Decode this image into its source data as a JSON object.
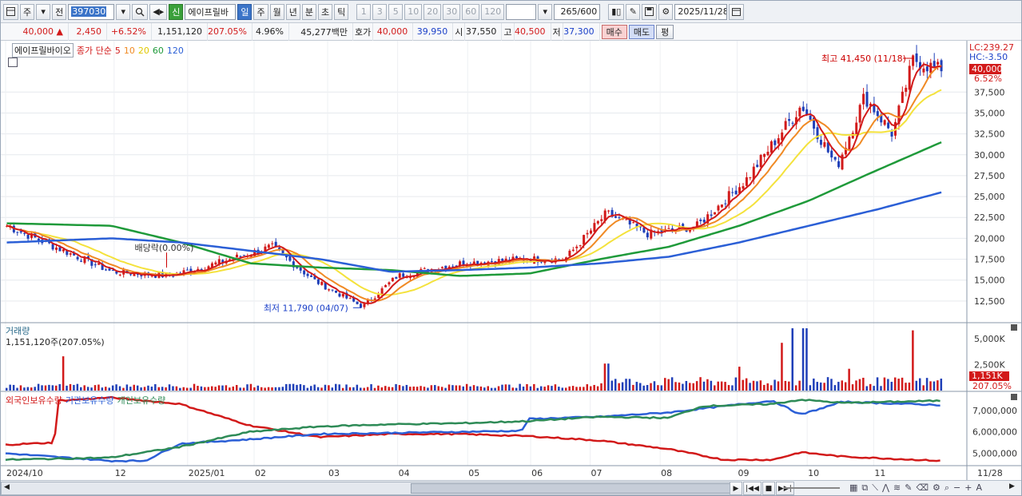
{
  "toolbar": {
    "period_first": "주",
    "prev_label": "전",
    "stock_code": "397030",
    "new_badge": "신",
    "stock_name": "에이프릴바",
    "tabs": [
      "일",
      "주",
      "월",
      "년",
      "분",
      "초",
      "틱"
    ],
    "active_tab": "일",
    "intervals": [
      "1",
      "3",
      "5",
      "10",
      "20",
      "30",
      "60",
      "120"
    ],
    "count": "265",
    "count_total": "/600",
    "date": "2025/11/28"
  },
  "quote": {
    "price": "40,000",
    "change": "2,450",
    "change_pct": "+6.52%",
    "volume": "1,151,120",
    "volume_ratio": "207.05%",
    "turnover": "4.96%",
    "amount": "45,277백만",
    "bid_label": "호가",
    "ask": "40,000",
    "bid": "39,950",
    "open_label": "시",
    "open": "37,550",
    "high_label": "고",
    "high": "40,500",
    "low_label": "저",
    "low": "37,300",
    "buy_label": "매수",
    "sell_label": "매도",
    "flat_label": "평"
  },
  "price_panel": {
    "stock_name": "에이프릴바이오",
    "ma_label": "종가 단순",
    "ma_periods": [
      "5",
      "10",
      "20",
      "60",
      "120"
    ],
    "ma_colors": [
      "#d21a1a",
      "#f08a24",
      "#f4e23c",
      "#1f9a3a",
      "#2b5fd6"
    ],
    "high_annotation": "최고 41,450 (11/18)",
    "low_annotation": "최저 11,790 (04/07)",
    "dividend_annotation": "배당락(0.00%)",
    "lc_label": "LC:239.27",
    "hc_label": "HC:-3.50",
    "current_tag": "40,000",
    "current_pct": "6.52%",
    "y_ticks": [
      "37,500",
      "35,000",
      "32,500",
      "30,000",
      "27,500",
      "25,000",
      "22,500",
      "20,000",
      "17,500",
      "15,000",
      "12,500"
    ]
  },
  "volume_panel": {
    "title": "거래량",
    "value": "1,151,120주(207.05%)",
    "y_ticks": [
      "5,000K",
      "2,500K"
    ],
    "current_tag": "1,151K",
    "current_pct": "207.05%"
  },
  "holdings_panel": {
    "series": [
      "외국인보유수량",
      "기관보유수량",
      "개인보유수량"
    ],
    "series_colors": [
      "#d21a1a",
      "#2b5fd6",
      "#2e8b57"
    ],
    "y_ticks": [
      "7,000,000",
      "6,000,000",
      "5,000,000"
    ]
  },
  "x_axis": [
    "2024/10",
    "12",
    "2025/01",
    "02",
    "03",
    "04",
    "05",
    "06",
    "07",
    "08",
    "09",
    "10",
    "11",
    "11/28"
  ],
  "chart_data": [
    {
      "type": "line",
      "title": "에이프릴바이오",
      "series": [
        {
          "name": "5",
          "values": []
        },
        {
          "name": "10",
          "values": []
        },
        {
          "name": "20",
          "values": []
        },
        {
          "name": "60",
          "values": []
        },
        {
          "name": "120",
          "values": []
        }
      ],
      "x": [
        "2024/10",
        "12",
        "2025/01",
        "02",
        "03",
        "04",
        "05",
        "06",
        "07",
        "08",
        "09",
        "10",
        "11",
        "11/28"
      ],
      "close_points": [
        [
          0,
          21500
        ],
        [
          1.5,
          16000
        ],
        [
          2.3,
          15500
        ],
        [
          2.8,
          16500
        ],
        [
          3.8,
          19000
        ],
        [
          4.4,
          15000
        ],
        [
          5.1,
          11800
        ],
        [
          5.6,
          15500
        ],
        [
          6.5,
          17000
        ],
        [
          7.4,
          17500
        ],
        [
          8.0,
          17500
        ],
        [
          8.6,
          23000
        ],
        [
          9.2,
          20500
        ],
        [
          9.9,
          21500
        ],
        [
          10.6,
          27000
        ],
        [
          11.4,
          36000
        ],
        [
          11.9,
          28500
        ],
        [
          12.3,
          37000
        ],
        [
          12.7,
          32500
        ],
        [
          13.0,
          41450
        ],
        [
          13.4,
          40000
        ]
      ],
      "ma60_points": [
        [
          0,
          21800
        ],
        [
          1.5,
          21500
        ],
        [
          2.5,
          19500
        ],
        [
          3.5,
          17000
        ],
        [
          4.5,
          16500
        ],
        [
          5.5,
          16200
        ],
        [
          6.5,
          15500
        ],
        [
          7.5,
          15800
        ],
        [
          8.5,
          17500
        ],
        [
          9.5,
          19000
        ],
        [
          10.5,
          21500
        ],
        [
          11.5,
          24500
        ],
        [
          12.3,
          27500
        ],
        [
          13.4,
          31500
        ]
      ],
      "ma120_points": [
        [
          0,
          19500
        ],
        [
          1.5,
          20000
        ],
        [
          2.5,
          19500
        ],
        [
          3.5,
          18500
        ],
        [
          4.5,
          17500
        ],
        [
          5.5,
          16000
        ],
        [
          6.5,
          16200
        ],
        [
          7.5,
          16500
        ],
        [
          8.5,
          17000
        ],
        [
          9.5,
          17800
        ],
        [
          10.5,
          19500
        ],
        [
          11.5,
          21500
        ],
        [
          12.5,
          23500
        ],
        [
          13.4,
          25500
        ]
      ],
      "ylim": [
        10000,
        42500
      ]
    },
    {
      "type": "bar",
      "title": "거래량",
      "ylim": [
        0,
        6000000
      ],
      "volume_spikes": [
        [
          0.8,
          3300000
        ],
        [
          6.5,
          500000
        ],
        [
          8.6,
          2600000
        ],
        [
          10.5,
          2300000
        ],
        [
          11.1,
          4600000
        ],
        [
          11.25,
          7000000
        ],
        [
          11.45,
          6200000
        ],
        [
          12.1,
          2100000
        ],
        [
          13.0,
          5800000
        ],
        [
          13.4,
          1151120
        ]
      ]
    },
    {
      "type": "line",
      "series": [
        {
          "name": "외국인보유수량",
          "values": [
            [
              0,
              5400000
            ],
            [
              0.7,
              5500000
            ],
            [
              0.75,
              7450000
            ],
            [
              1.5,
              7600000
            ],
            [
              2.5,
              7300000
            ],
            [
              3.5,
              6300000
            ],
            [
              4.5,
              5750000
            ],
            [
              5.5,
              5900000
            ],
            [
              6.5,
              5900000
            ],
            [
              7.5,
              5800000
            ],
            [
              8.5,
              5600000
            ],
            [
              9.5,
              5200000
            ],
            [
              10.3,
              4700000
            ],
            [
              11.0,
              4700000
            ],
            [
              11.4,
              5050000
            ],
            [
              12.0,
              4850000
            ],
            [
              13.4,
              4650000
            ]
          ]
        },
        {
          "name": "기관보유수량",
          "values": [
            [
              0,
              5000000
            ],
            [
              1.5,
              4650000
            ],
            [
              2.0,
              4650000
            ],
            [
              2.5,
              5450000
            ],
            [
              3.5,
              5650000
            ],
            [
              4.5,
              5900000
            ],
            [
              5.5,
              5950000
            ],
            [
              6.5,
              6000000
            ],
            [
              7.4,
              6050000
            ],
            [
              7.5,
              6600000
            ],
            [
              8.5,
              6700000
            ],
            [
              9.5,
              6900000
            ],
            [
              10.3,
              7200000
            ],
            [
              11.0,
              7450000
            ],
            [
              11.4,
              6800000
            ],
            [
              12.0,
              7400000
            ],
            [
              13.4,
              7250000
            ]
          ]
        },
        {
          "name": "개인보유수량",
          "values": [
            [
              0,
              4700000
            ],
            [
              1.5,
              4800000
            ],
            [
              2.5,
              5300000
            ],
            [
              3.5,
              6000000
            ],
            [
              4.5,
              6250000
            ],
            [
              5.5,
              6350000
            ],
            [
              6.5,
              6400000
            ],
            [
              7.5,
              6500000
            ],
            [
              8.5,
              6700000
            ],
            [
              9.5,
              6650000
            ],
            [
              10.0,
              7200000
            ],
            [
              11.0,
              7300000
            ],
            [
              11.4,
              7500000
            ],
            [
              12.0,
              7350000
            ],
            [
              13.4,
              7450000
            ]
          ]
        }
      ],
      "ylim": [
        4500000,
        7700000
      ]
    }
  ]
}
